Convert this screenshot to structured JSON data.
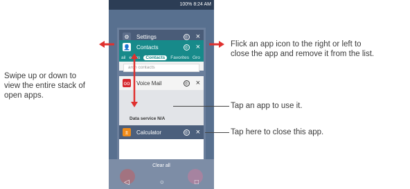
{
  "annotations": {
    "swipe_lines": [
      "Swipe up or down to",
      "view the entire stack of",
      "open apps."
    ],
    "flick_lines": [
      "Flick an app icon to the right or left to",
      "close the app and remove it from the list."
    ],
    "tap_app": "Tap an app to use it.",
    "tap_close": "Tap here to close this app."
  },
  "status_bar": {
    "text": "100% 8:24 AM"
  },
  "cards": {
    "settings": {
      "title": "Settings",
      "icon": "gear-icon"
    },
    "contacts": {
      "title": "Contacts",
      "tabs": [
        "ail",
        "eams",
        "Contacts",
        "Favorites",
        "Gro"
      ],
      "active_tab": "Contacts",
      "search_placeholder": "arch contacts"
    },
    "voicemail": {
      "title": "Voice Mail",
      "body_text": "Data service N/A"
    },
    "calculator": {
      "title": "Calculator"
    }
  },
  "clear_all_label": "Clear all",
  "navbar": {
    "back": "◁",
    "home": "○",
    "recents": "□"
  },
  "colors": {
    "arrow_red": "#e0302e",
    "contacts_teal": "#178a8a",
    "voicemail_red": "#d6262d",
    "calculator_orange": "#f08c1a"
  }
}
